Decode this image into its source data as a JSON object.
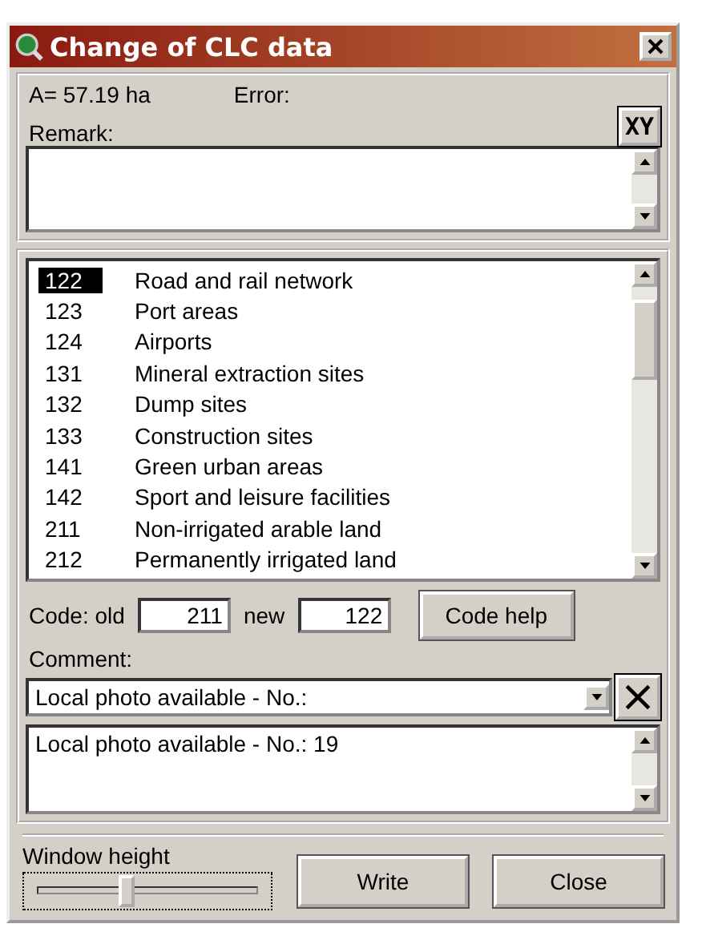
{
  "window": {
    "title": "Change of CLC data"
  },
  "area": "A= 57.19 ha",
  "error_label": "Error:",
  "remark_label": "Remark:",
  "xy_button": "XY",
  "codes": [
    {
      "code": "122",
      "name": "Road and rail network",
      "selected": true
    },
    {
      "code": "123",
      "name": "Port areas",
      "selected": false
    },
    {
      "code": "124",
      "name": "Airports",
      "selected": false
    },
    {
      "code": "131",
      "name": "Mineral extraction sites",
      "selected": false
    },
    {
      "code": "132",
      "name": "Dump sites",
      "selected": false
    },
    {
      "code": "133",
      "name": "Construction sites",
      "selected": false
    },
    {
      "code": "141",
      "name": "Green urban areas",
      "selected": false
    },
    {
      "code": "142",
      "name": "Sport and leisure facilities",
      "selected": false
    },
    {
      "code": "211",
      "name": "Non-irrigated arable land",
      "selected": false
    },
    {
      "code": "212",
      "name": "Permanently irrigated land",
      "selected": false
    }
  ],
  "code_label": "Code: old",
  "old_code": "211",
  "new_label": "new",
  "new_code": "122",
  "code_help": "Code help",
  "comment_label": "Comment:",
  "comment_combo": "Local photo available - No.:",
  "comment_text": "Local photo available - No.: 19",
  "window_height": {
    "label": "Window height",
    "level": 0.38
  },
  "buttons": [
    "Write",
    "Close"
  ]
}
